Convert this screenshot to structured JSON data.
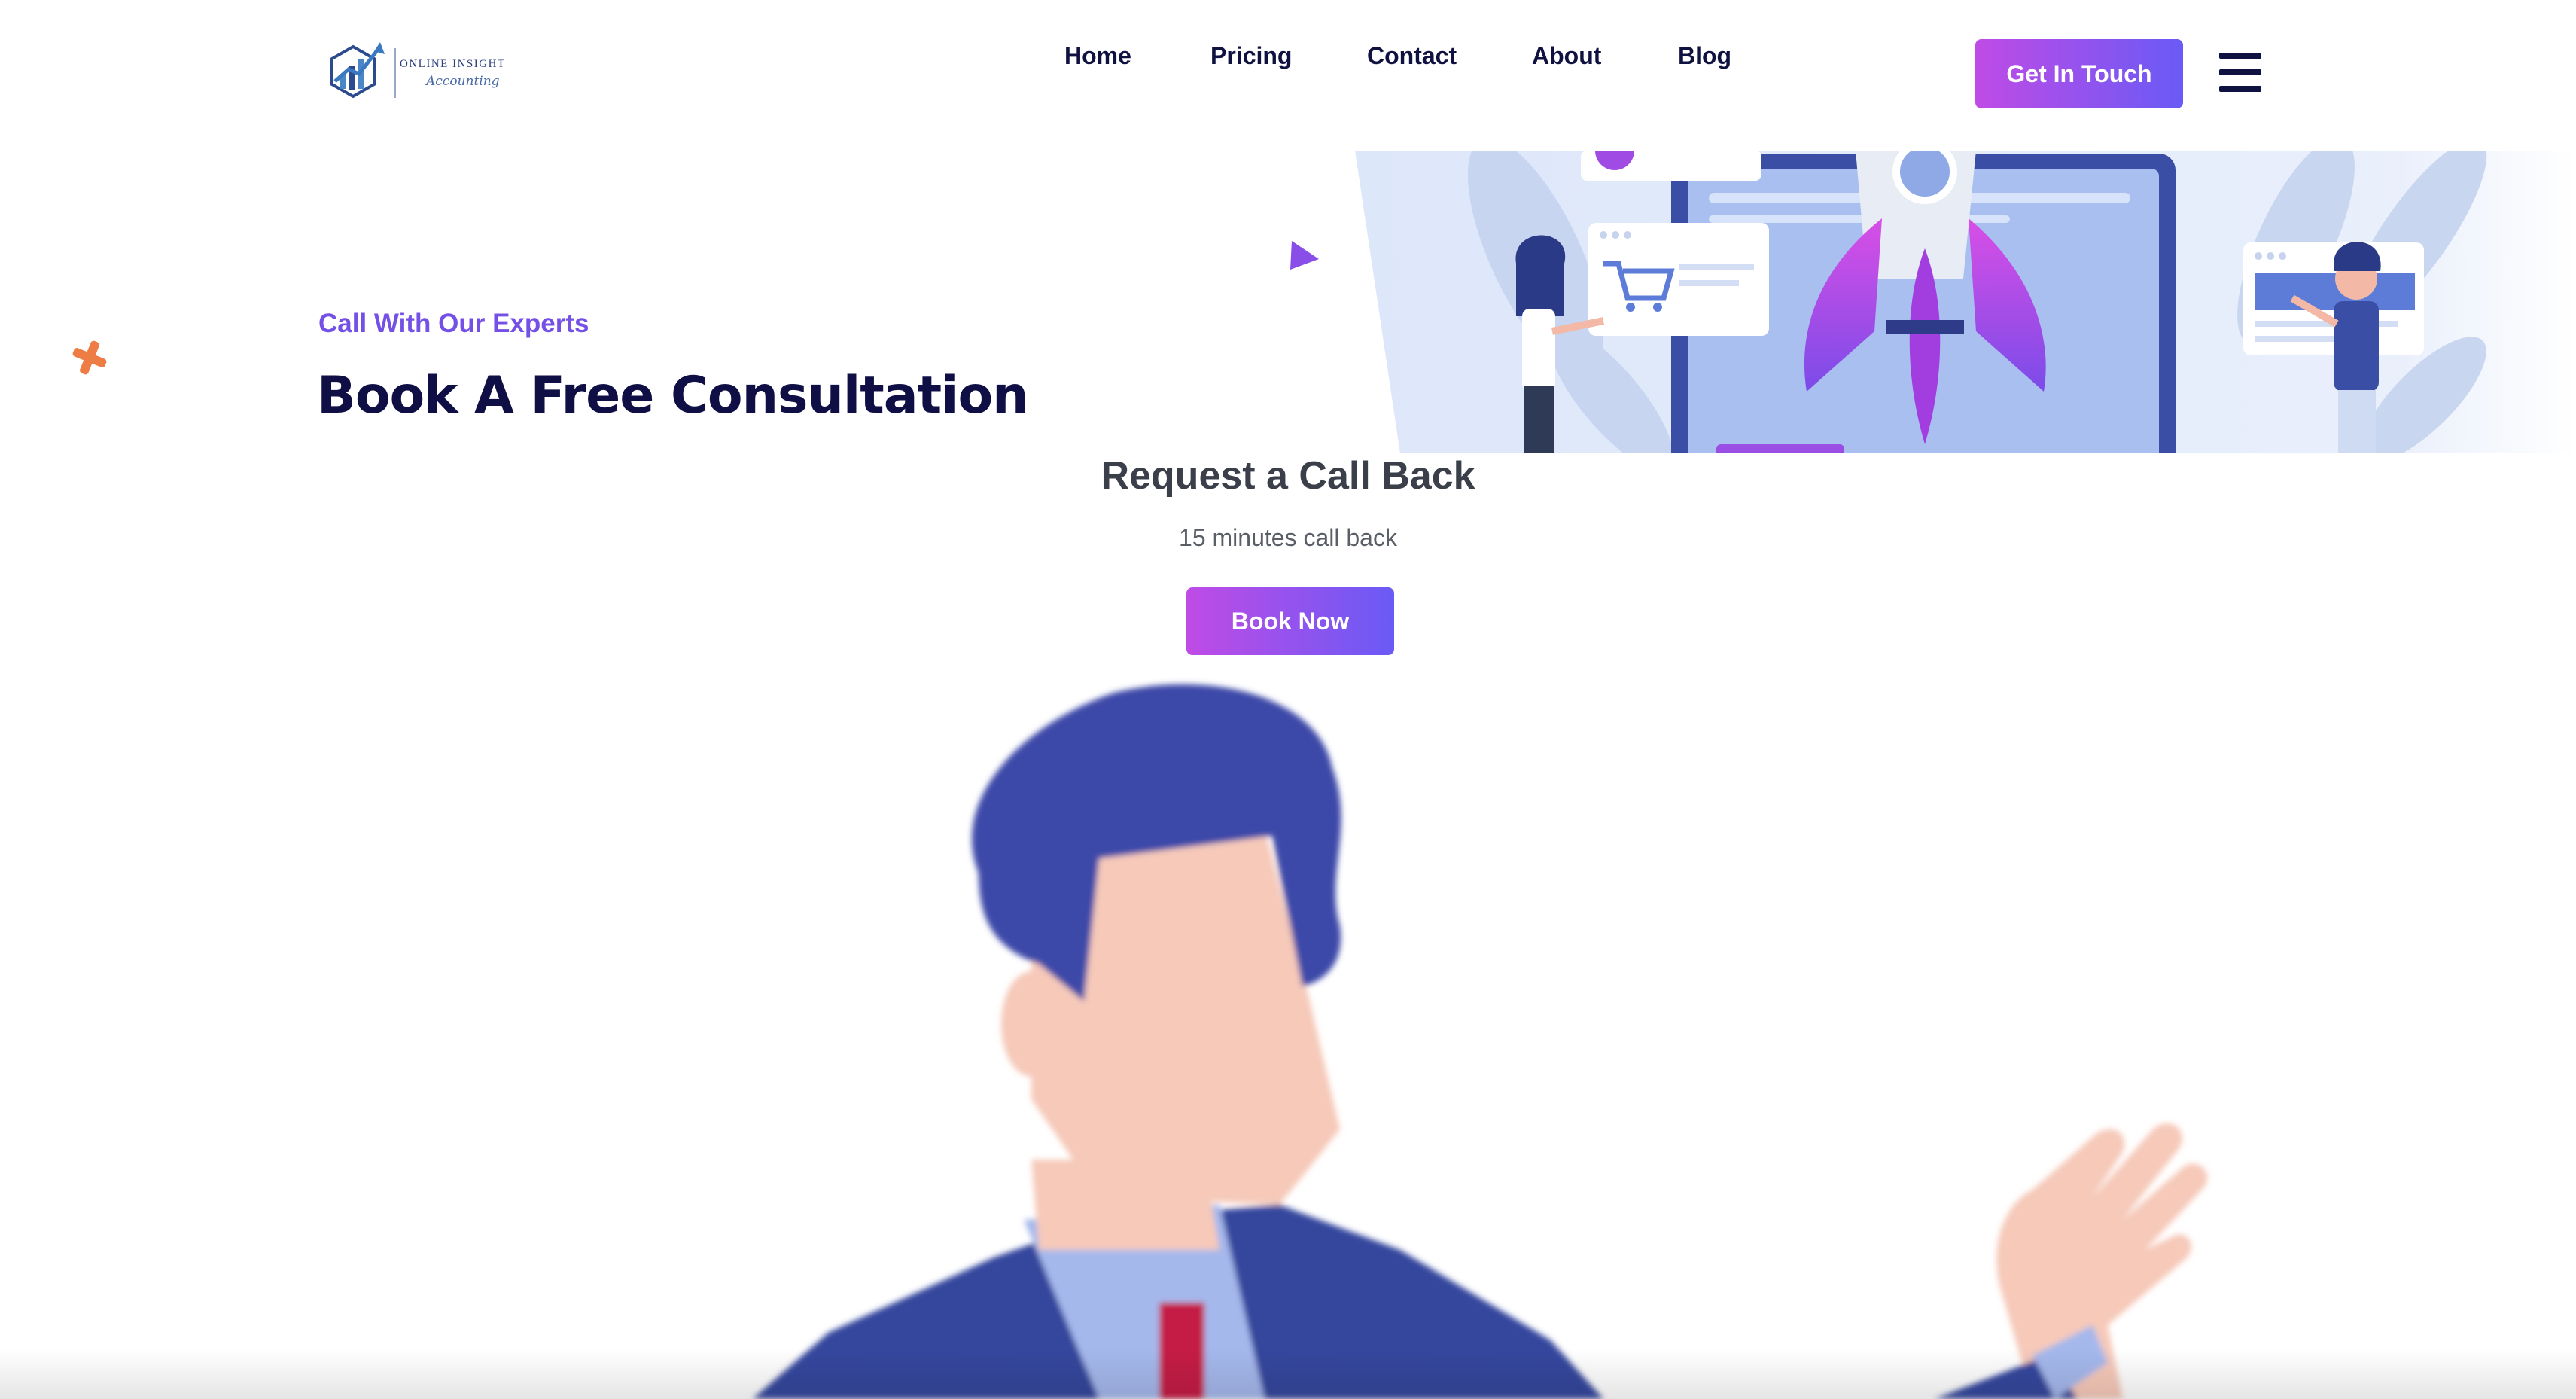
{
  "header": {
    "logo_name": "ONLINE INSIGHT",
    "logo_sub": "Accounting",
    "nav": [
      {
        "label": "Home"
      },
      {
        "label": "Pricing"
      },
      {
        "label": "Contact"
      },
      {
        "label": "About"
      },
      {
        "label": "Blog"
      }
    ],
    "cta_label": "Get In Touch",
    "menu_icon": "hamburger-menu-icon"
  },
  "hero": {
    "eyebrow": "Call With Our Experts",
    "title": "Book A Free Consultation"
  },
  "callback": {
    "title": "Request a Call Back",
    "subtitle": "15 minutes call back",
    "button_label": "Book Now"
  },
  "colors": {
    "accent_gradient_start": "#c04be6",
    "accent_gradient_end": "#6a5af5",
    "heading_navy": "#0f0f45",
    "eyebrow_purple": "#7450e6",
    "decor_orange": "#ee7d45"
  }
}
